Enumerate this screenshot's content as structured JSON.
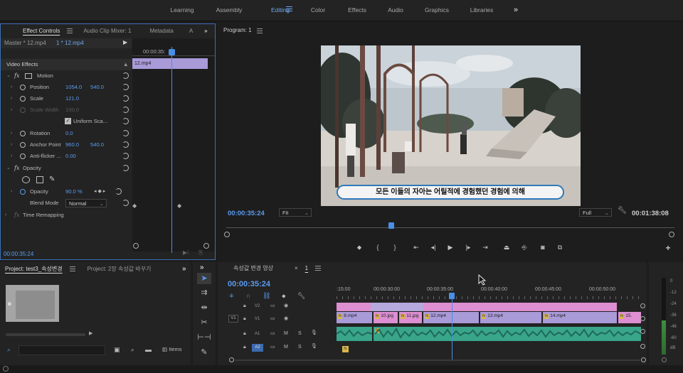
{
  "workspaces": [
    {
      "label": "Learning",
      "w": 48
    },
    {
      "label": "Assembly",
      "w": 84
    },
    {
      "label": "Editing",
      "w": 60,
      "active": true
    },
    {
      "label": "Color",
      "w": 46
    },
    {
      "label": "Effects",
      "w": 64
    },
    {
      "label": "Audio",
      "w": 44
    },
    {
      "label": "Graphics",
      "w": 72
    },
    {
      "label": "Libraries",
      "w": 54
    }
  ],
  "effect_controls": {
    "tabs": [
      "Effect Controls",
      "Audio Clip Mixer: 1",
      "Metadata",
      "A"
    ],
    "master_label": "Master * 12.mp4",
    "clip_label": "1 * 12.mp4",
    "ruler_time": "00:00:35:",
    "clip_bar_label": "12.mp4",
    "section_video": "Video Effects",
    "motion": "Motion",
    "position_label": "Position",
    "position_x": "1054.0",
    "position_y": "540.0",
    "scale_label": "Scale",
    "scale_value": "121.0",
    "scale_width_label": "Scale Width",
    "scale_width_value": "100.0",
    "uniform_scale": "Uniform Sca...",
    "rotation_label": "Rotation",
    "rotation_value": "0.0",
    "anchor_label": "Anchor Point",
    "anchor_x": "960.0",
    "anchor_y": "540.0",
    "antiflicker_label": "Anti-flicker ...",
    "antiflicker_value": "0.00",
    "opacity_section": "Opacity",
    "opacity_label": "Opacity",
    "opacity_value": "90.0 %",
    "blend_label": "Blend Mode",
    "blend_value": "Normal",
    "time_remap": "Time Remapping",
    "footer_time": "00:00:35:24"
  },
  "program": {
    "title": "Program: 1",
    "subtitle": "모든 이들의 자아는 어릴적에 경험했던 경험에 의해",
    "current_time": "00:00:35:24",
    "fit_value": "Fit",
    "quality_value": "Full",
    "duration": "00:01:38:08"
  },
  "project": {
    "tabs": [
      "Project: test3_속성변경",
      "Project: 2장 속성값 바꾸기"
    ],
    "items_label": "Items"
  },
  "timeline": {
    "tab_label": "속성값 변경 영상",
    "sequence_tab": "1",
    "timecode": "00:00:35:24",
    "ruler": [
      ":15:00",
      "00:00:30:00",
      "00:00:35:00",
      "00:00:40:00",
      "00:00:45:00",
      "00:00:50:00"
    ],
    "tracks": {
      "v2": "V2",
      "v1": "V1",
      "a1": "A1",
      "a2": "A2",
      "v1_src": "V1",
      "a1_src": "A1",
      "a2_src": "A2"
    },
    "clips": [
      "8.mp4",
      "10.jpg",
      "11.jpg",
      "12.mp4",
      "13.mp4",
      "14.mp4",
      "15."
    ],
    "mute": "M",
    "solo": "S"
  },
  "meters": [
    "0",
    "-12",
    "-24",
    "-36",
    "-48",
    "-60",
    "dB"
  ],
  "colors": {
    "accent": "#4a8ee8",
    "clip_video": "#a99ad8",
    "clip_pink": "#dd8fd2",
    "clip_audio": "#39a58a",
    "subtitle_border": "#2f79b8"
  }
}
